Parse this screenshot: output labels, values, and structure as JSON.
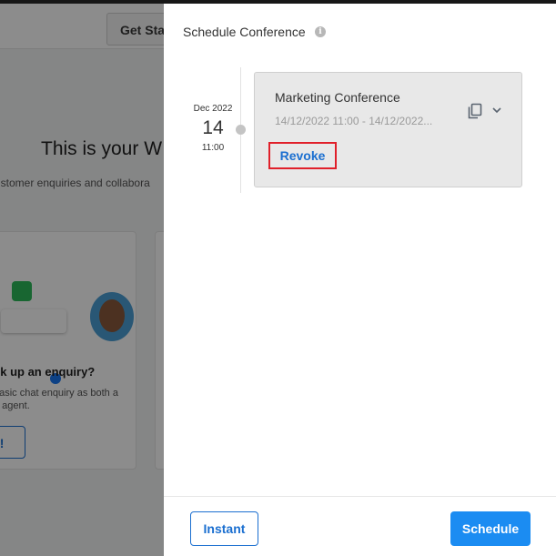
{
  "background": {
    "get_started_label": "Get Sta",
    "welcome_heading": "This is your W",
    "welcome_subtext": "ustomer enquiries and collabora",
    "card": {
      "title": "ck up an enquiry?",
      "text": "basic chat enquiry as both a n agent.",
      "button_label": "y!"
    }
  },
  "drawer": {
    "title": "Schedule Conference",
    "info_icon": "i"
  },
  "timeline": {
    "month_year": "Dec 2022",
    "day": "14",
    "time": "11:00"
  },
  "event": {
    "name": "Marketing Conference",
    "range": "14/12/2022 11:00 - 14/12/2022...",
    "revoke_label": "Revoke",
    "icons": [
      "copy-icon",
      "chevron-down-icon"
    ]
  },
  "footer": {
    "instant_label": "Instant",
    "schedule_label": "Schedule"
  },
  "colors": {
    "accent": "#1b8cf2",
    "link": "#1b6fd0",
    "highlight_border": "#e0202a",
    "card_bg": "#e8e8e8"
  }
}
